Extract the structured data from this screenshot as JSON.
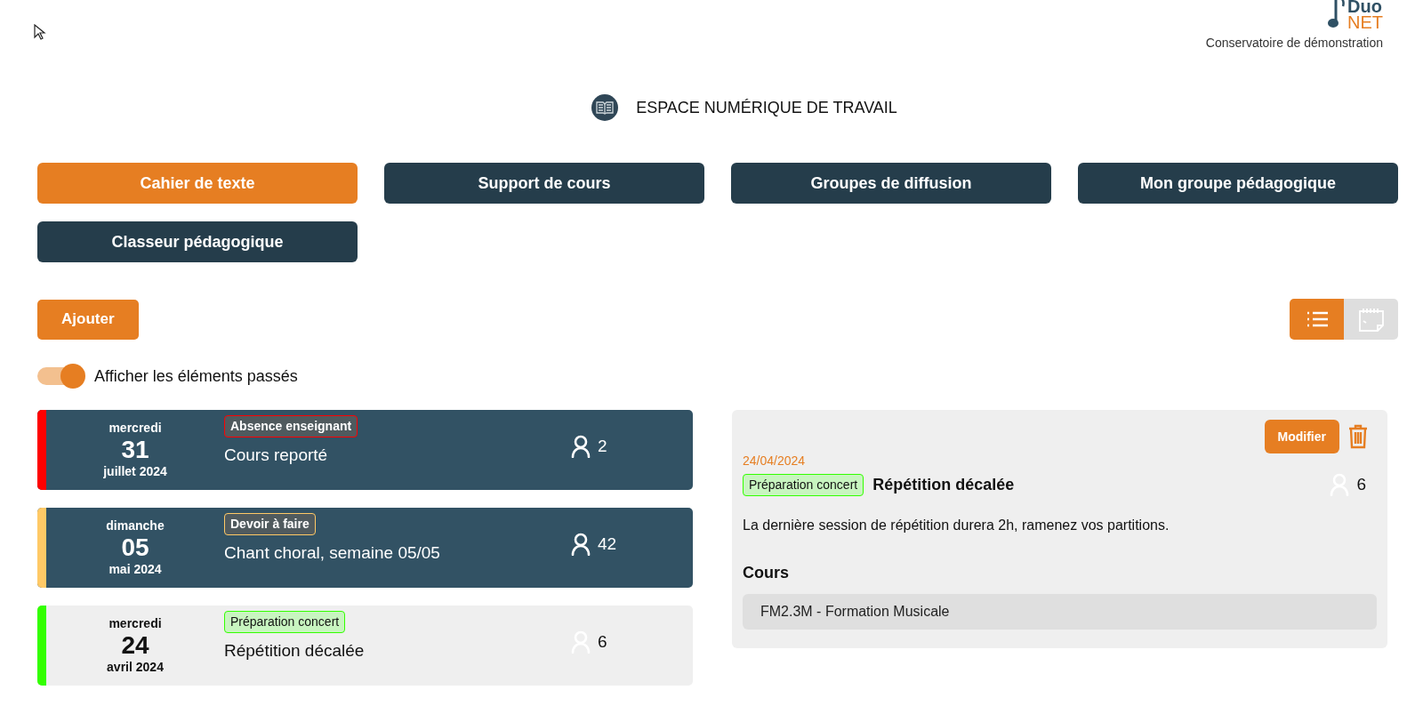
{
  "brand": {
    "logo_top": "Duo",
    "logo_bottom": "NET",
    "subtitle": "Conservatoire de démonstration"
  },
  "page_title": "ESPACE NUMÉRIQUE DE TRAVAIL",
  "tabs": [
    {
      "label": "Cahier de texte",
      "selected": true
    },
    {
      "label": "Support de cours",
      "selected": false
    },
    {
      "label": "Groupes de diffusion",
      "selected": false
    },
    {
      "label": "Mon groupe pédagogique",
      "selected": false
    },
    {
      "label": "Classeur pédagogique",
      "selected": false
    }
  ],
  "add_button": "Ajouter",
  "view_toggle": [
    {
      "kind": "list",
      "selected": true
    },
    {
      "kind": "calendar",
      "selected": false
    }
  ],
  "past_toggle": {
    "label": "Afficher les éléments passés",
    "on": true
  },
  "entries": [
    {
      "weekday": "mercredi",
      "day": "31",
      "month_year": "juillet 2024",
      "tag": "Absence enseignant",
      "title": "Cours reporté",
      "count": "2",
      "color": "#ff0000",
      "selected": false
    },
    {
      "weekday": "dimanche",
      "day": "05",
      "month_year": "mai 2024",
      "tag": "Devoir à faire",
      "title": "Chant choral, semaine 05/05",
      "count": "42",
      "color": "#ffc966",
      "selected": false
    },
    {
      "weekday": "mercredi",
      "day": "24",
      "month_year": "avril 2024",
      "tag": "Préparation concert",
      "title": "Répétition décalée",
      "count": "6",
      "color": "#33ff00",
      "selected": true
    }
  ],
  "detail": {
    "edit_button": "Modifier",
    "date": "24/04/2024",
    "tag": "Préparation concert",
    "title": "Répétition décalée",
    "count": "6",
    "description": "La dernière session de répétition durera 2h, ramenez vos partitions.",
    "courses_heading": "Cours",
    "courses": [
      "FM2.3M - Formation Musicale"
    ]
  }
}
